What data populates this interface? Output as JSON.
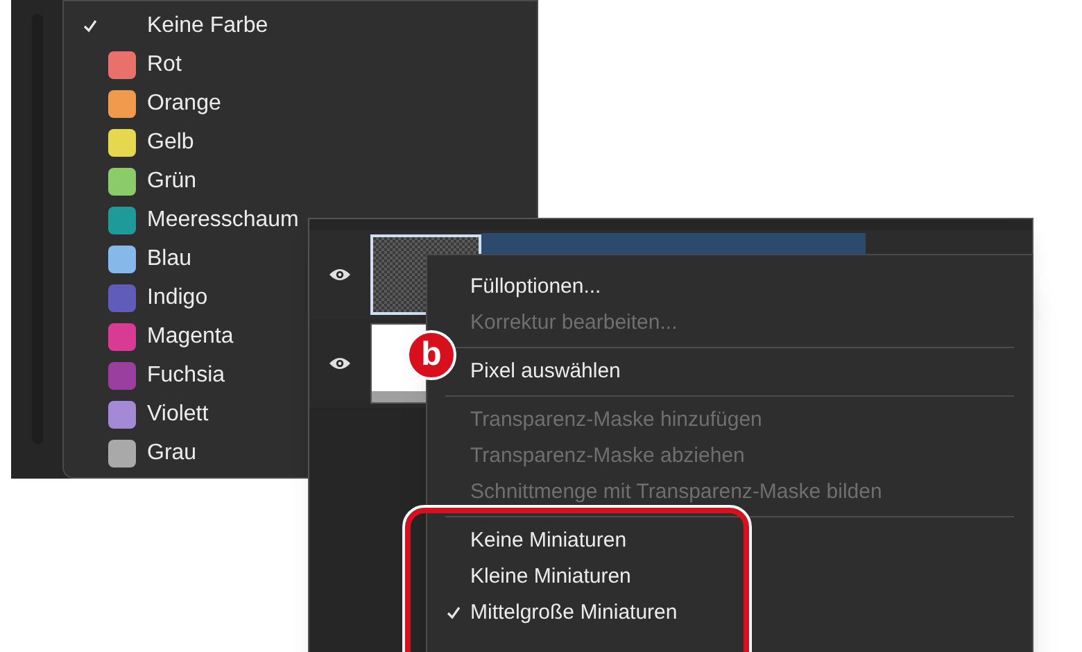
{
  "color_menu": {
    "items": [
      {
        "kind": "none",
        "label": "Keine Farbe",
        "checked": true
      },
      {
        "kind": "swatch",
        "label": "Rot",
        "checked": false,
        "color": "#e8726b"
      },
      {
        "kind": "swatch",
        "label": "Orange",
        "checked": false,
        "color": "#f09a4e"
      },
      {
        "kind": "swatch",
        "label": "Gelb",
        "checked": false,
        "color": "#e6d84e"
      },
      {
        "kind": "swatch",
        "label": "Grün",
        "checked": false,
        "color": "#8ccb6a"
      },
      {
        "kind": "swatch",
        "label": "Meeresschaum",
        "checked": false,
        "color": "#1e9a9a"
      },
      {
        "kind": "swatch",
        "label": "Blau",
        "checked": false,
        "color": "#86b8ea"
      },
      {
        "kind": "swatch",
        "label": "Indigo",
        "checked": false,
        "color": "#5f5cba"
      },
      {
        "kind": "swatch",
        "label": "Magenta",
        "checked": false,
        "color": "#d83a94"
      },
      {
        "kind": "swatch",
        "label": "Fuchsia",
        "checked": false,
        "color": "#9a3ea0"
      },
      {
        "kind": "swatch",
        "label": "Violett",
        "checked": false,
        "color": "#a48ad6"
      },
      {
        "kind": "swatch",
        "label": "Grau",
        "checked": false,
        "color": "#a9a9a9"
      }
    ]
  },
  "layers": [
    {
      "kind": "transparent",
      "selected": true,
      "visible": true
    },
    {
      "kind": "white",
      "selected": false,
      "visible": true
    }
  ],
  "annotation": {
    "label": "b"
  },
  "context_menu": {
    "groups": [
      [
        {
          "label": "Fülloptionen...",
          "disabled": false,
          "checked": false
        },
        {
          "label": "Korrektur bearbeiten...",
          "disabled": true,
          "checked": false
        }
      ],
      [
        {
          "label": "Pixel auswählen",
          "disabled": false,
          "checked": false
        }
      ],
      [
        {
          "label": "Transparenz-Maske hinzufügen",
          "disabled": true,
          "checked": false
        },
        {
          "label": "Transparenz-Maske abziehen",
          "disabled": true,
          "checked": false
        },
        {
          "label": "Schnittmenge mit Transparenz-Maske bilden",
          "disabled": true,
          "checked": false
        }
      ],
      [
        {
          "label": "Keine Miniaturen",
          "disabled": false,
          "checked": false
        },
        {
          "label": "Kleine Miniaturen",
          "disabled": false,
          "checked": false
        },
        {
          "label": "Mittelgroße Miniaturen",
          "disabled": false,
          "checked": true
        }
      ]
    ]
  }
}
